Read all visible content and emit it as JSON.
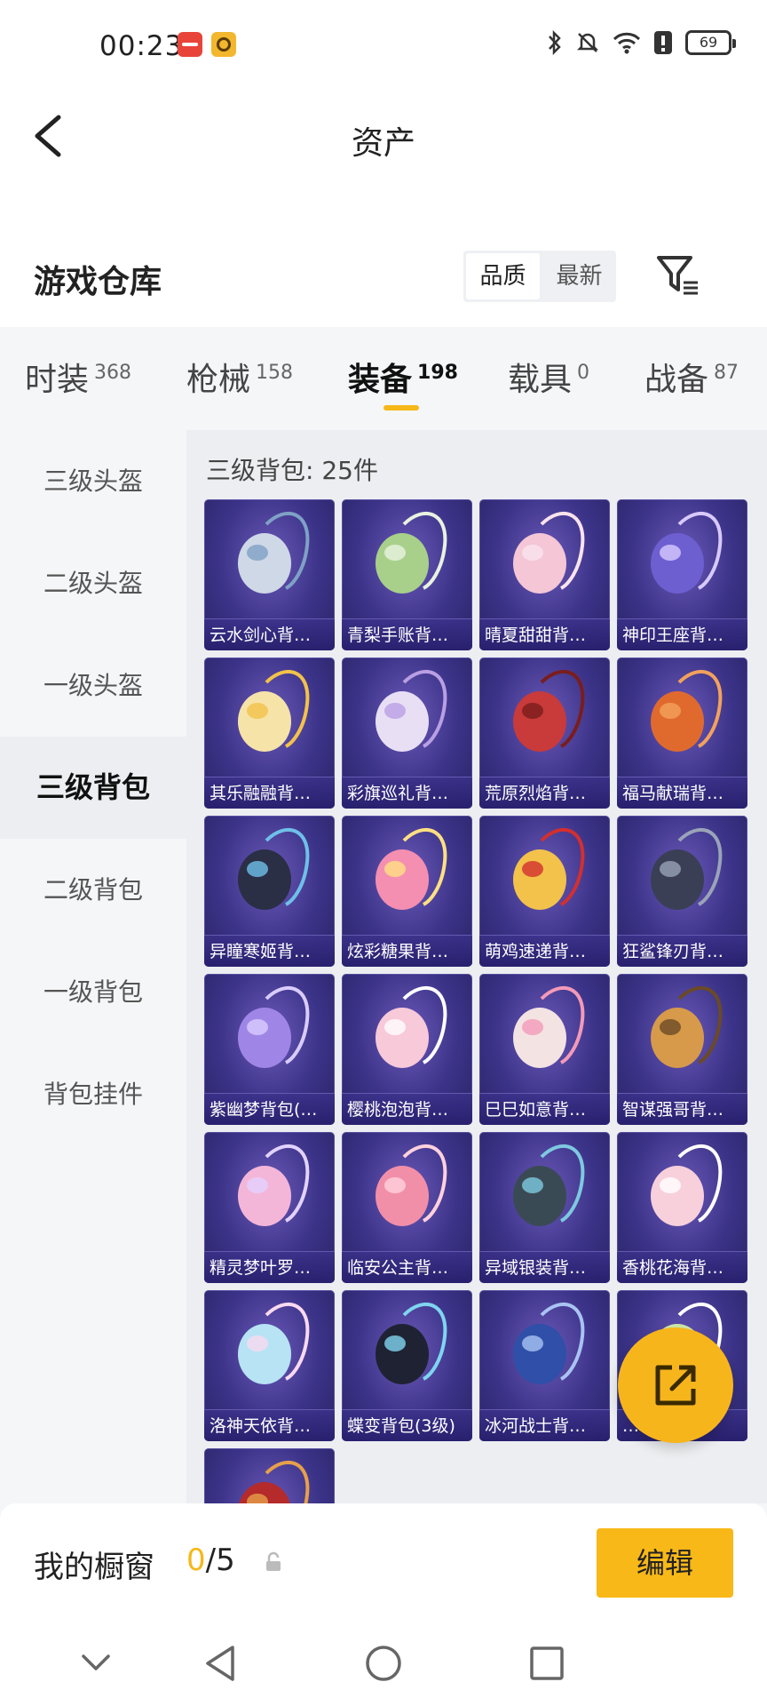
{
  "status": {
    "time": "00:23",
    "battery": "69"
  },
  "header": {
    "title": "资产"
  },
  "section": {
    "title": "游戏仓库",
    "sort_options": [
      "品质",
      "最新"
    ]
  },
  "tabs": [
    {
      "label": "时装",
      "count": "368"
    },
    {
      "label": "枪械",
      "count": "158"
    },
    {
      "label": "装备",
      "count": "198"
    },
    {
      "label": "载具",
      "count": "0"
    },
    {
      "label": "战备",
      "count": "87"
    }
  ],
  "sidenav": [
    "三级头盔",
    "二级头盔",
    "一级头盔",
    "三级背包",
    "二级背包",
    "一级背包",
    "背包挂件"
  ],
  "content": {
    "title": "三级背包: 25件",
    "items": [
      "云水剑心背…",
      "青梨手账背…",
      "晴夏甜甜背…",
      "神印王座背…",
      "其乐融融背…",
      "彩旗巡礼背…",
      "荒原烈焰背…",
      "福马献瑞背…",
      "异瞳寒姬背…",
      "炫彩糖果背…",
      "萌鸡速递背…",
      "狂鲨锋刃背…",
      "紫幽梦背包(…",
      "樱桃泡泡背…",
      "巳巳如意背…",
      "智谋强哥背…",
      "精灵梦叶罗…",
      "临安公主背…",
      "异域银装背…",
      "香桃花海背…",
      "洛神天依背…",
      "蝶变背包(3级)",
      "冰河战士背…",
      "…",
      ""
    ]
  },
  "bottom": {
    "label": "我的橱窗",
    "count_current": "0",
    "count_total": "/5",
    "edit": "编辑"
  },
  "colors": {
    "accent": "#f6b719",
    "card_bg": "#3b3388"
  }
}
